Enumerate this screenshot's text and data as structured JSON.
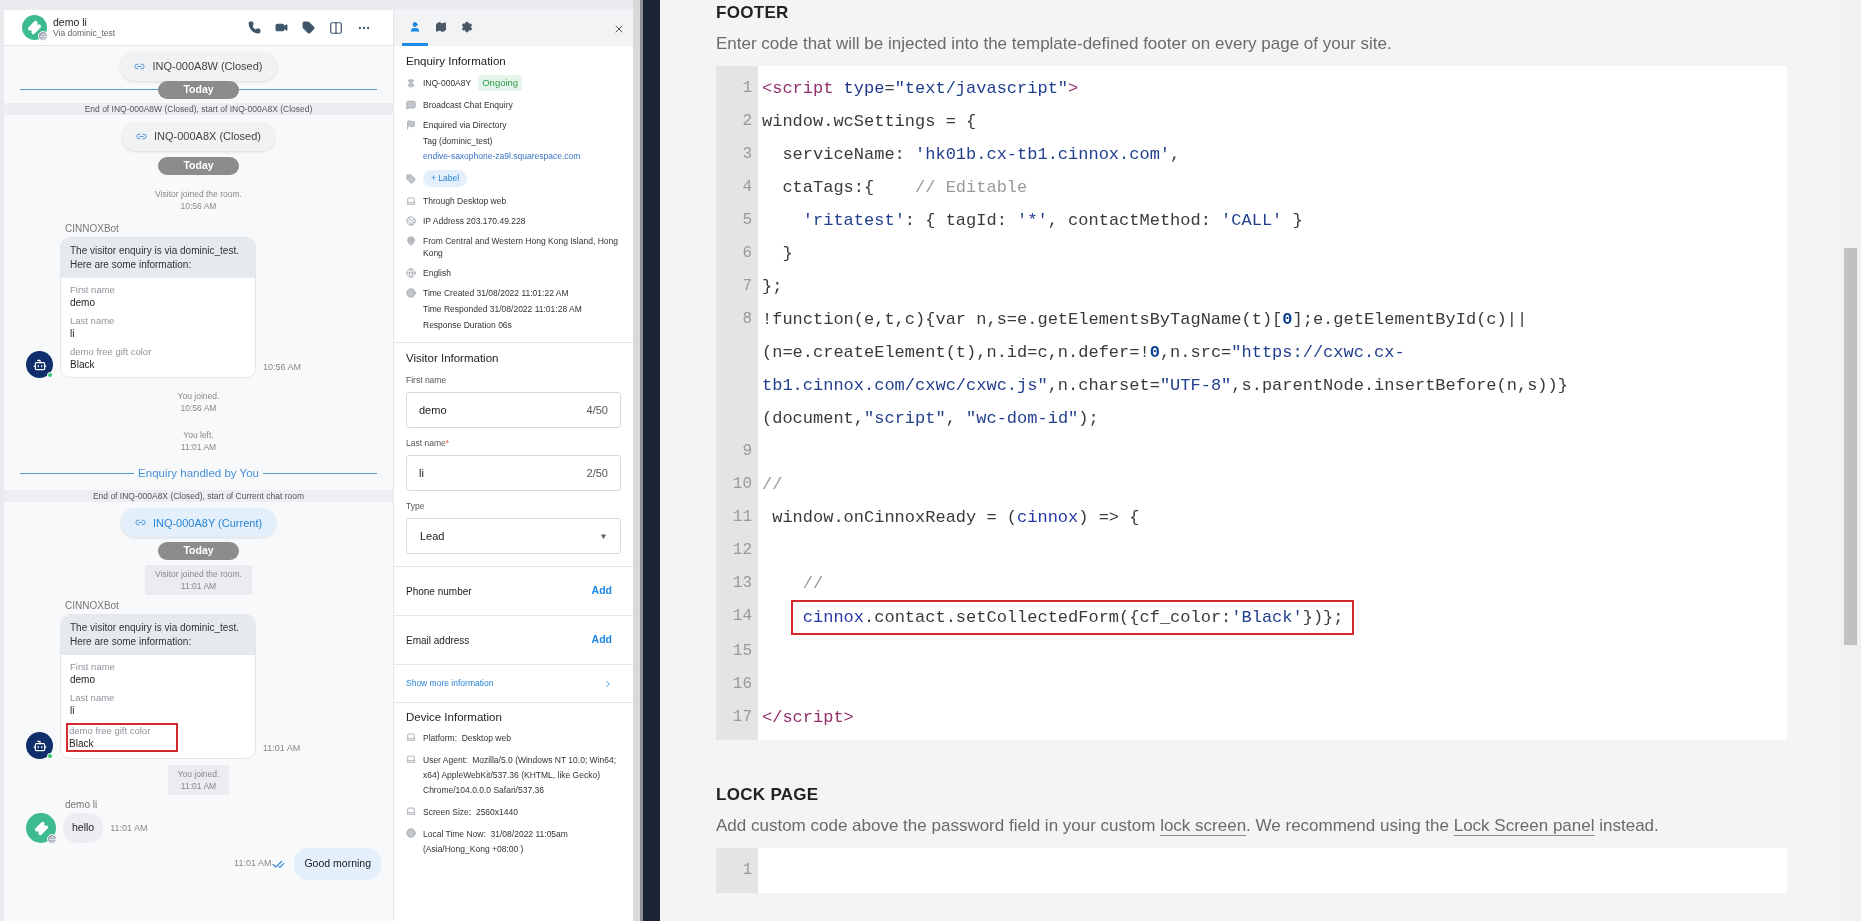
{
  "chat": {
    "contact": {
      "name": "demo li",
      "via": "Via dominic_test"
    },
    "timeline": [
      {
        "kind": "enquiry_chip",
        "label": "INQ-000A8W (Closed)",
        "current": false
      },
      {
        "kind": "date",
        "label": "Today",
        "line": true
      },
      {
        "kind": "band",
        "text": "End of INQ-000A8W (Closed), start of INQ-000A8X (Closed)"
      },
      {
        "kind": "enquiry_chip",
        "label": "INQ-000A8X (Closed)",
        "current": false
      },
      {
        "kind": "date",
        "label": "Today",
        "line": false
      },
      {
        "kind": "system",
        "lines": [
          "Visitor joined the room.",
          "10:56 AM"
        ],
        "boxed": false
      },
      {
        "kind": "bot_card",
        "sender": "CINNOXBot",
        "intro": [
          "The visitor enquiry is via dominic_test.",
          "Here are some information:"
        ],
        "time": "10:56 AM",
        "fields": [
          {
            "label": "First name",
            "value": "demo",
            "highlighted": false
          },
          {
            "label": "Last name",
            "value": "li",
            "highlighted": false
          },
          {
            "label": "demo free gift color",
            "value": "Black",
            "highlighted": false
          }
        ]
      },
      {
        "kind": "system",
        "lines": [
          "You joined.",
          "10:56 AM"
        ],
        "boxed": false
      },
      {
        "kind": "system",
        "lines": [
          "You left.",
          "11:01 AM"
        ],
        "boxed": false
      },
      {
        "kind": "handled",
        "label": "Enquiry handled by You"
      },
      {
        "kind": "band",
        "text": "End of INQ-000A8X (Closed), start of Current chat room"
      },
      {
        "kind": "enquiry_chip",
        "label": "INQ-000A8Y (Current)",
        "current": true
      },
      {
        "kind": "date",
        "label": "Today",
        "line": false
      },
      {
        "kind": "system",
        "lines": [
          "Visitor joined the room.",
          "11:01 AM"
        ],
        "boxed": true
      },
      {
        "kind": "bot_card",
        "sender": "CINNOXBot",
        "intro": [
          "The visitor enquiry is via dominic_test.",
          "Here are some information:"
        ],
        "time": "11:01 AM",
        "fields": [
          {
            "label": "First name",
            "value": "demo",
            "highlighted": false
          },
          {
            "label": "Last name",
            "value": "li",
            "highlighted": false
          },
          {
            "label": "demo free gift color",
            "value": "Black",
            "highlighted": true
          }
        ]
      },
      {
        "kind": "system",
        "lines": [
          "You joined.",
          "11:01 AM"
        ],
        "boxed": true
      },
      {
        "kind": "incoming",
        "sender": "demo li",
        "text": "hello",
        "time": "11:01 AM"
      },
      {
        "kind": "outgoing",
        "text": "Good morning",
        "time": "11:01 AM",
        "read": true
      }
    ]
  },
  "details_panel": {
    "tabs": [
      {
        "selected": true
      },
      {
        "selected": false
      },
      {
        "selected": false
      }
    ],
    "enquiry": {
      "title": "Enquiry Information",
      "rows": [
        {
          "kind": "id",
          "text": "INQ-000A8Y",
          "status": "Ongoing"
        },
        {
          "kind": "text",
          "lines": [
            "Broadcast Chat Enquiry"
          ]
        },
        {
          "kind": "text",
          "lines": [
            "Enquired via Directory",
            "Tag (dominic_test)"
          ],
          "link": "endive-saxophone-za9l.squarespace.com"
        },
        {
          "kind": "label",
          "button": "+ Label"
        },
        {
          "kind": "text",
          "lines": [
            "Through Desktop web"
          ]
        },
        {
          "kind": "text",
          "lines": [
            "IP Address 203.170.49.228"
          ]
        },
        {
          "kind": "text",
          "lines": [
            "From Central and Western Hong Kong Island, Hong Kong"
          ]
        },
        {
          "kind": "text",
          "lines": [
            "English"
          ]
        },
        {
          "kind": "text",
          "lines": [
            "Time Created 31/08/2022 11:01:22 AM",
            "Time Responded 31/08/2022 11:01:28 AM",
            "Response Duration 06s"
          ]
        }
      ]
    },
    "visitor": {
      "title": "Visitor Information",
      "fields": [
        {
          "kind": "text",
          "label": "First name",
          "value": "demo",
          "counter": "4/50"
        },
        {
          "kind": "text",
          "label": "Last name",
          "required_mark": "*",
          "value": "li",
          "counter": "2/50"
        },
        {
          "kind": "select",
          "label": "Type",
          "value": "Lead"
        }
      ],
      "contacts": [
        {
          "label": "Phone number",
          "action": "Add"
        },
        {
          "label": "Email address",
          "action": "Add"
        }
      ],
      "show_more": "Show more information"
    },
    "device": {
      "title": "Device Information",
      "rows": [
        {
          "text": "Platform:  Desktop web"
        },
        {
          "text": "User Agent:  Mozilla/5.0 (Windows NT 10.0; Win64; x64) AppleWebKit/537.36 (KHTML, like Gecko) Chrome/104.0.0.0 Safari/537.36"
        },
        {
          "text": "Screen Size:  2560x1440"
        },
        {
          "text": "Local Time Now:  31/08/2022 11:05am (Asia/Hong_Kong +08:00 )"
        }
      ]
    }
  },
  "settings_page": {
    "sections": [
      {
        "heading": "FOOTER",
        "description": [
          {
            "text": "Enter code that will be injected into the template-defined footer on every page of your site.",
            "link": false
          }
        ],
        "code": [
          {
            "number": "1",
            "highlighted": false,
            "tokens": [
              {
                "text": "<script",
                "kind": "tag"
              },
              {
                "text": " type",
                "kind": "attr"
              },
              {
                "text": "=",
                "kind": "plain"
              },
              {
                "text": "\"text/javascript\"",
                "kind": "string"
              },
              {
                "text": ">",
                "kind": "tag"
              }
            ]
          },
          {
            "number": "2",
            "highlighted": false,
            "tokens": [
              {
                "text": "window.wcSettings = {",
                "kind": "plain"
              }
            ]
          },
          {
            "number": "3",
            "highlighted": false,
            "tokens": [
              {
                "text": "  serviceName: ",
                "kind": "plain"
              },
              {
                "text": "'hk01b.cx-tb1.cinnox.com'",
                "kind": "string"
              },
              {
                "text": ",",
                "kind": "plain"
              }
            ]
          },
          {
            "number": "4",
            "highlighted": false,
            "tokens": [
              {
                "text": "  ctaTags:{    ",
                "kind": "plain"
              },
              {
                "text": "// Editable",
                "kind": "comment"
              }
            ]
          },
          {
            "number": "5",
            "highlighted": false,
            "tokens": [
              {
                "text": "    'ritatest'",
                "kind": "string"
              },
              {
                "text": ": { tagId: ",
                "kind": "plain"
              },
              {
                "text": "'*'",
                "kind": "string"
              },
              {
                "text": ", contactMethod: ",
                "kind": "plain"
              },
              {
                "text": "'CALL'",
                "kind": "string"
              },
              {
                "text": " }",
                "kind": "plain"
              }
            ]
          },
          {
            "number": "6",
            "highlighted": false,
            "tokens": [
              {
                "text": "  }",
                "kind": "plain"
              }
            ]
          },
          {
            "number": "7",
            "highlighted": false,
            "tokens": [
              {
                "text": "};",
                "kind": "plain"
              }
            ]
          },
          {
            "number": "8",
            "highlighted": false,
            "tokens": [
              {
                "text": "!function(e,t,c){var n,s=e.getElementsByTagName(t)[",
                "kind": "plain"
              },
              {
                "text": "0",
                "kind": "number"
              },
              {
                "text": "];e.getElementById(c)||(n=e.createElement(t),n.id=c,n.defer=!",
                "kind": "plain"
              },
              {
                "text": "0",
                "kind": "number"
              },
              {
                "text": ",n.src=",
                "kind": "plain"
              },
              {
                "text": "\"https://cxwc.cx-tb1.cinnox.com/cxwc/cxwc.js\"",
                "kind": "string"
              },
              {
                "text": ",n.charset=",
                "kind": "plain"
              },
              {
                "text": "\"UTF-8\"",
                "kind": "string"
              },
              {
                "text": ",s.parentNode.insertBefore(n,s))}(document,",
                "kind": "plain"
              },
              {
                "text": "\"script\"",
                "kind": "string"
              },
              {
                "text": ", ",
                "kind": "plain"
              },
              {
                "text": "\"wc-dom-id\"",
                "kind": "string"
              },
              {
                "text": ");",
                "kind": "plain"
              }
            ]
          },
          {
            "number": "9"
          },
          {
            "number": "10",
            "highlighted": false,
            "tokens": [
              {
                "text": "//",
                "kind": "comment"
              }
            ]
          },
          {
            "number": "11",
            "highlighted": false,
            "tokens": [
              {
                "text": " window.onCinnoxReady = (",
                "kind": "plain"
              },
              {
                "text": "cinnox",
                "kind": "variable"
              },
              {
                "text": ") => {",
                "kind": "plain"
              }
            ]
          },
          {
            "number": "12"
          },
          {
            "number": "13",
            "highlighted": false,
            "tokens": [
              {
                "text": "    //",
                "kind": "comment"
              }
            ]
          },
          {
            "number": "14",
            "highlighted": true,
            "tokens": [
              {
                "text": "    cinnox",
                "kind": "variable"
              },
              {
                "text": ".contact.setCollectedForm({cf_color:",
                "kind": "plain"
              },
              {
                "text": "'Black'",
                "kind": "string"
              },
              {
                "text": "})};",
                "kind": "plain"
              }
            ]
          },
          {
            "number": "15"
          },
          {
            "number": "16"
          },
          {
            "number": "17",
            "highlighted": false,
            "tokens": [
              {
                "text": "</script>",
                "kind": "tag"
              }
            ]
          }
        ]
      },
      {
        "heading": "LOCK PAGE",
        "description": [
          {
            "text": "Add custom code above the password field in your custom ",
            "link": false
          },
          {
            "text": "lock screen",
            "link": true
          },
          {
            "text": ". We recommend using the ",
            "link": false
          },
          {
            "text": "Lock Screen panel",
            "link": true
          },
          {
            "text": " instead.",
            "link": false
          }
        ],
        "code": [
          {
            "number": "1"
          }
        ]
      }
    ]
  }
}
